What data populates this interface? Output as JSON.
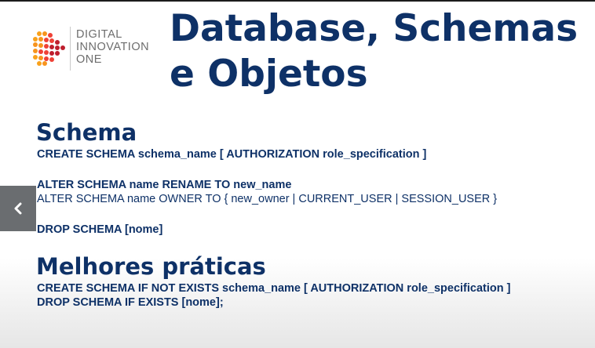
{
  "logo": {
    "line1": "DIGITAL",
    "line2": "INNOVATION",
    "line3": "ONE",
    "colors": [
      "#f7941d",
      "#ef4136",
      "#be1e2d",
      "#f9a11b"
    ]
  },
  "title": {
    "line1": "Database, Schemas",
    "line2": "e Objetos",
    "color": "#0e3167"
  },
  "schema_section": {
    "heading": "Schema",
    "create": "CREATE SCHEMA schema_name [ AUTHORIZATION role_specification ]",
    "alter_rename": "ALTER SCHEMA name RENAME TO new_name",
    "alter_owner": "ALTER SCHEMA name OWNER TO { new_owner | CURRENT_USER | SESSION_USER }",
    "drop": "DROP SCHEMA [nome]"
  },
  "best_practices": {
    "heading": "Melhores práticas",
    "create": "CREATE SCHEMA IF NOT EXISTS schema_name [ AUTHORIZATION role_specification ]",
    "drop": "DROP SCHEMA IF EXISTS [nome];"
  },
  "nav": {
    "prev_icon": "chevron-left-icon"
  }
}
